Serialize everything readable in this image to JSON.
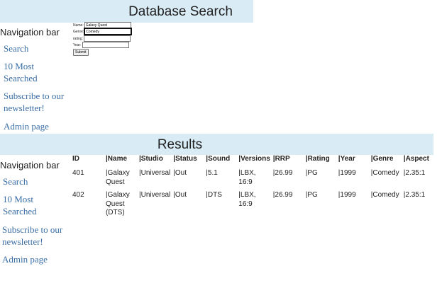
{
  "search_banner": {
    "title": "Database Search"
  },
  "nav_top": {
    "heading": "Navigation bar",
    "links": [
      "Search",
      "10 Most",
      "Searched",
      "Subscribe to our",
      "newsletter!",
      "Admin page"
    ]
  },
  "search_form": {
    "name_label": "Name:",
    "name_value": "Galaxy Quest",
    "genre_label": "Genre:",
    "genre_value": "Comedy",
    "rating_label": "rating:",
    "rating_value": "",
    "year_label": "Year:",
    "year_value": "",
    "submit_label": "Submit"
  },
  "results_banner": {
    "title": "Results"
  },
  "nav_bottom": {
    "heading": "Navigation bar",
    "links": [
      "Search",
      "10 Most",
      "Searched",
      "Subscribe to our",
      "newsletter!",
      "Admin page"
    ]
  },
  "results_table": {
    "headers": [
      "ID",
      "|Name",
      "|Studio",
      "|Status",
      "|Sound",
      "|Versions",
      "|RRP",
      "|Rating",
      "|Year",
      "|Genre",
      "|Aspect"
    ],
    "rows": [
      {
        "id": "401",
        "name_lines": [
          "|Galaxy",
          "Quest"
        ],
        "studio": "|Universal",
        "status": "|Out",
        "sound": "|5.1",
        "versions": "|LBX, 16:9",
        "rrp": "|26.99",
        "rating": "|PG",
        "year": "|1999",
        "genre": "|Comedy",
        "aspect": "|2.35:1"
      },
      {
        "id": "402",
        "name_lines": [
          "|Galaxy",
          "Quest",
          "(DTS)"
        ],
        "studio": "|Universal",
        "status": "|Out",
        "sound": "|DTS",
        "versions": "|LBX, 16:9",
        "rrp": "|26.99",
        "rating": "|PG",
        "year": "|1999",
        "genre": "|Comedy",
        "aspect": "|2.35:1"
      }
    ]
  }
}
